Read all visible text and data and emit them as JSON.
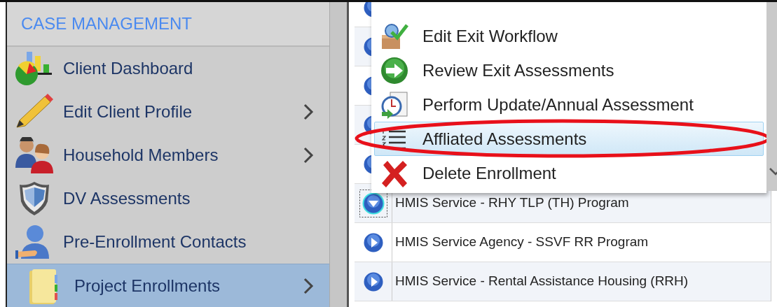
{
  "sidebar": {
    "title": "CASE MANAGEMENT",
    "items": [
      {
        "label": "Client Dashboard",
        "has_submenu": false,
        "selected": false
      },
      {
        "label": "Edit Client Profile",
        "has_submenu": true,
        "selected": false
      },
      {
        "label": "Household Members",
        "has_submenu": true,
        "selected": false
      },
      {
        "label": "DV Assessments",
        "has_submenu": false,
        "selected": false
      },
      {
        "label": "Pre-Enrollment Contacts",
        "has_submenu": false,
        "selected": false
      },
      {
        "label": "Project Enrollments",
        "has_submenu": true,
        "selected": true
      }
    ]
  },
  "table": {
    "rows": [
      {
        "expanded": false,
        "focused": false
      },
      {
        "expanded": false,
        "focused": false
      },
      {
        "expanded": false,
        "focused": false
      },
      {
        "expanded": false,
        "focused": false
      },
      {
        "expanded": false,
        "focused": false
      },
      {
        "text": "HMIS Service - RHY TLP (TH) Program",
        "expanded": true,
        "focused": true
      },
      {
        "text": "HMIS Service Agency - SSVF RR Program",
        "expanded": false,
        "focused": false
      },
      {
        "text": "HMIS Service - Rental Assistance Housing (RRH)",
        "expanded": false,
        "focused": false
      }
    ]
  },
  "context_menu": {
    "items": [
      {
        "label": "Edit Exit Workflow",
        "selected": false,
        "circled": false
      },
      {
        "label": "Review Exit Assessments",
        "selected": false,
        "circled": false
      },
      {
        "label": "Perform Update/Annual Assessment",
        "selected": false,
        "circled": false
      },
      {
        "label": "Affliated Assessments",
        "selected": true,
        "circled": true
      },
      {
        "label": "Delete Enrollment",
        "selected": false,
        "circled": false
      }
    ]
  }
}
